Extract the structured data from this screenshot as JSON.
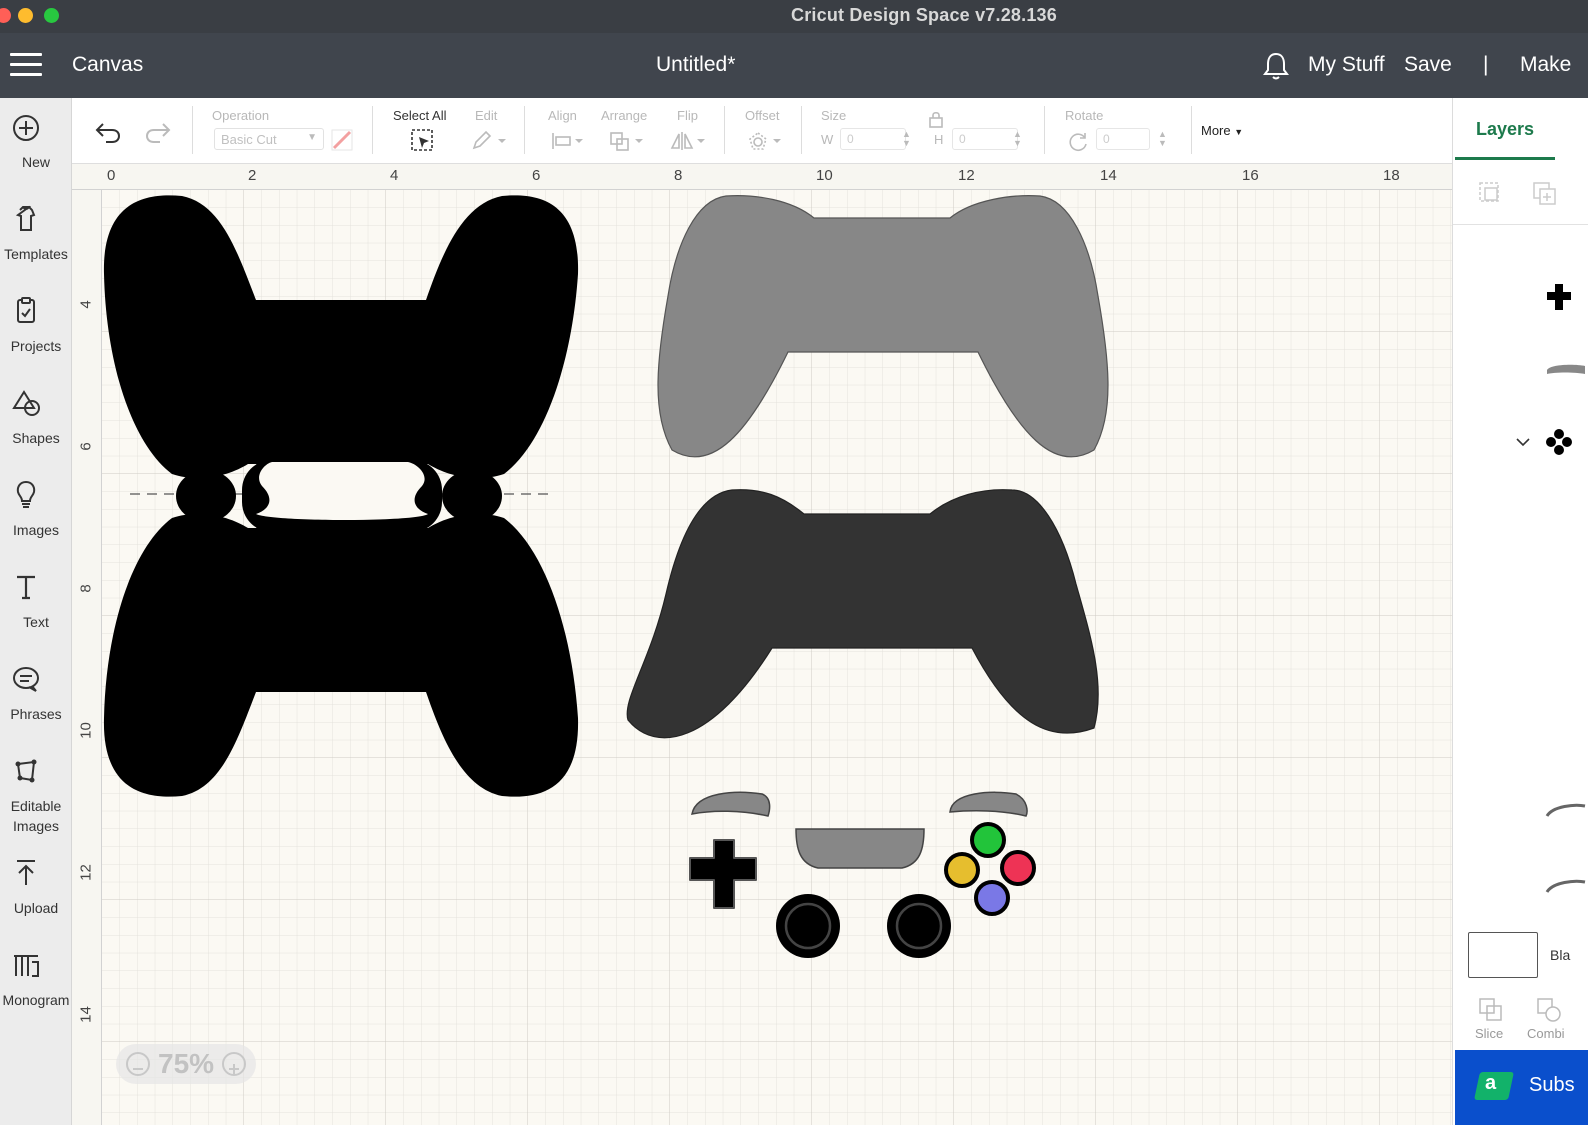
{
  "window": {
    "title": "Cricut Design Space  v7.28.136"
  },
  "header": {
    "canvas_label": "Canvas",
    "doc_title": "Untitled*",
    "my_stuff": "My Stuff",
    "save": "Save",
    "separator": "|",
    "make": "Make"
  },
  "sidebar": {
    "items": [
      {
        "label": "New",
        "icon": "plus-circle-icon"
      },
      {
        "label": "Templates",
        "icon": "tshirt-icon"
      },
      {
        "label": "Projects",
        "icon": "clipboard-icon"
      },
      {
        "label": "Shapes",
        "icon": "shapes-icon"
      },
      {
        "label": "Images",
        "icon": "lightbulb-icon"
      },
      {
        "label": "Text",
        "icon": "text-icon"
      },
      {
        "label": "Phrases",
        "icon": "speech-bubble-icon"
      },
      {
        "label": "Editable\nImages",
        "icon": "editable-images-icon"
      },
      {
        "label": "Upload",
        "icon": "upload-icon"
      },
      {
        "label": "Monogram",
        "icon": "monogram-icon"
      }
    ]
  },
  "toolbar": {
    "operation_label": "Operation",
    "operation_value": "Basic Cut",
    "select_all": "Select All",
    "edit": "Edit",
    "align": "Align",
    "arrange": "Arrange",
    "flip": "Flip",
    "offset": "Offset",
    "size": "Size",
    "w_label": "W",
    "h_label": "H",
    "w_value": "0",
    "h_value": "0",
    "rotate": "Rotate",
    "rotate_value": "0",
    "more": "More"
  },
  "canvas": {
    "ruler_top": [
      "0",
      "2",
      "4",
      "6",
      "8",
      "10",
      "12",
      "14",
      "16",
      "18"
    ],
    "ruler_left": [
      "4",
      "6",
      "8",
      "10",
      "12",
      "14"
    ],
    "zoom": "75%",
    "colors": {
      "black_controller": "#000000",
      "gray_controller": "#878787",
      "dark_controller": "#333333",
      "green_button": "#22c43a",
      "red_button": "#ee3355",
      "yellow_button": "#e6be2e",
      "blue_button": "#7a78e6"
    }
  },
  "layers_panel": {
    "tab": "Layers",
    "blank_label": "Bla",
    "slice": "Slice",
    "combine": "Combi",
    "subscribe": "Subs"
  }
}
